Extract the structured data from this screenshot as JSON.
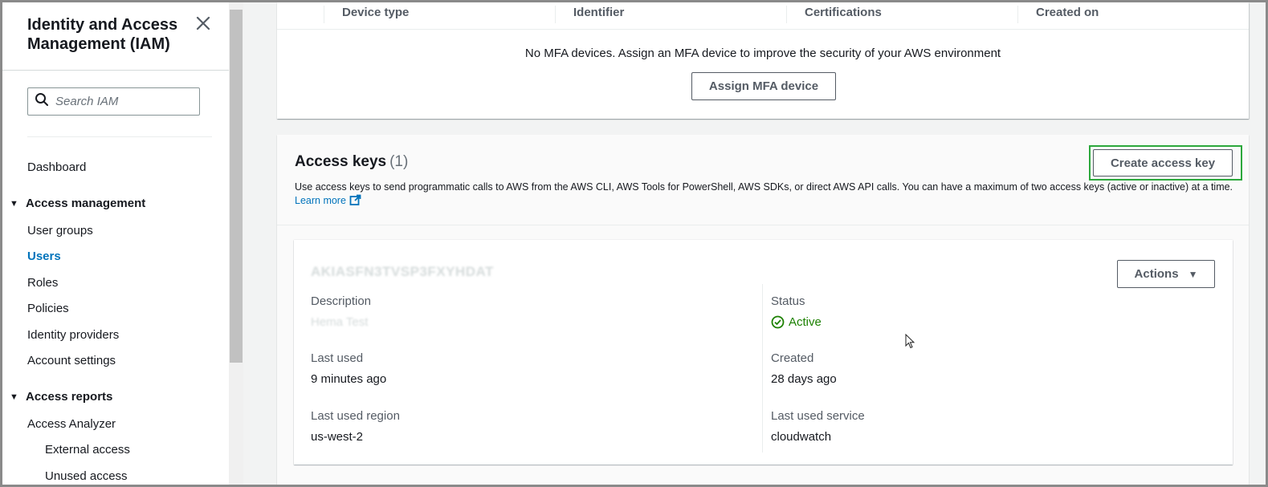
{
  "sidebar": {
    "title": "Identity and Access Management (IAM)",
    "search_placeholder": "Search IAM",
    "items": {
      "dashboard": "Dashboard",
      "access_management": "Access management",
      "user_groups": "User groups",
      "users": "Users",
      "roles": "Roles",
      "policies": "Policies",
      "identity_providers": "Identity providers",
      "account_settings": "Account settings",
      "access_reports": "Access reports",
      "access_analyzer": "Access Analyzer",
      "external_access": "External access",
      "unused_access": "Unused access"
    },
    "active_item": "Users"
  },
  "mfa": {
    "columns": [
      "Device type",
      "Identifier",
      "Certifications",
      "Created on"
    ],
    "empty_message": "No MFA devices. Assign an MFA device to improve the security of your AWS environment",
    "assign_button": "Assign MFA device"
  },
  "access_keys": {
    "title": "Access keys",
    "count": "(1)",
    "create_button": "Create access key",
    "description": "Use access keys to send programmatic calls to AWS from the AWS CLI, AWS Tools for PowerShell, AWS SDKs, or direct AWS API calls. You can have a maximum of two access keys (active or inactive) at a time.",
    "learn_more": "Learn more",
    "key": {
      "id": "AKIASFN3TVSP3FXYHDAT",
      "actions_button": "Actions",
      "description_label": "Description",
      "description_value": "Hema Test",
      "status_label": "Status",
      "status_value": "Active",
      "last_used_label": "Last used",
      "last_used_value": "9 minutes ago",
      "created_label": "Created",
      "created_value": "28 days ago",
      "last_used_region_label": "Last used region",
      "last_used_region_value": "us-west-2",
      "last_used_service_label": "Last used service",
      "last_used_service_value": "cloudwatch"
    }
  },
  "colors": {
    "accent_link": "#0073bb",
    "status_active": "#1d8102",
    "highlight_box": "#2ca83c"
  }
}
